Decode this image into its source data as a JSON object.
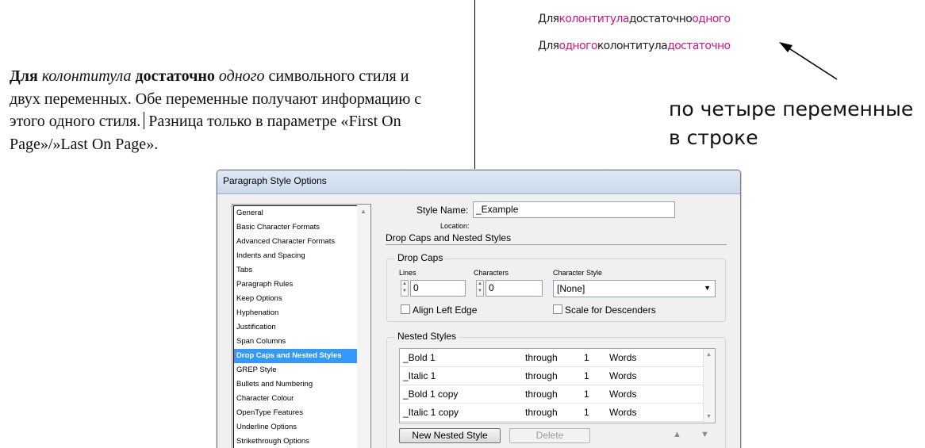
{
  "annotation": {
    "paragraph": {
      "w1": "Для",
      "w2": "колонтитула",
      "w3": "достаточно",
      "w4": "одного",
      "rest1": "символьного стиля и двух переменных. Обе переменные получают информацию с этого одного стиля.",
      "rest2": "Разница только в параметре «First On Page»/»Last On Page»."
    },
    "header_line_1": [
      {
        "text": "Для",
        "marked": false
      },
      {
        "text": "колонтитула",
        "marked": true
      },
      {
        "text": "достаточно",
        "marked": false
      },
      {
        "text": "одного",
        "marked": true
      }
    ],
    "header_line_2": [
      {
        "text": "Для",
        "marked": false
      },
      {
        "text": "одного",
        "marked": true
      },
      {
        "text": "колонтитула",
        "marked": false
      },
      {
        "text": "достаточно",
        "marked": true
      }
    ],
    "note_line_1": "по четыре переменные",
    "note_line_2": "в строке",
    "colors": {
      "magenta": "#d0148a",
      "text": "#111111"
    }
  },
  "dialog": {
    "title": "Paragraph Style Options",
    "sidebar": [
      {
        "label": "General",
        "selected": false
      },
      {
        "label": "Basic Character Formats",
        "selected": false
      },
      {
        "label": "Advanced Character Formats",
        "selected": false
      },
      {
        "label": "Indents and Spacing",
        "selected": false
      },
      {
        "label": "Tabs",
        "selected": false
      },
      {
        "label": "Paragraph Rules",
        "selected": false
      },
      {
        "label": "Keep Options",
        "selected": false
      },
      {
        "label": "Hyphenation",
        "selected": false
      },
      {
        "label": "Justification",
        "selected": false
      },
      {
        "label": "Span Columns",
        "selected": false
      },
      {
        "label": "Drop Caps and Nested Styles",
        "selected": true
      },
      {
        "label": "GREP Style",
        "selected": false
      },
      {
        "label": "Bullets and Numbering",
        "selected": false
      },
      {
        "label": "Character Colour",
        "selected": false
      },
      {
        "label": "OpenType Features",
        "selected": false
      },
      {
        "label": "Underline Options",
        "selected": false
      },
      {
        "label": "Strikethrough Options",
        "selected": false
      }
    ],
    "style_name_label": "Style Name:",
    "style_name_value": "_Example",
    "location_label": "Location:",
    "section_title": "Drop Caps and Nested Styles",
    "drop_caps": {
      "title": "Drop Caps",
      "lines_label": "Lines",
      "lines_value": "0",
      "characters_label": "Characters",
      "characters_value": "0",
      "char_style_label": "Character Style",
      "char_style_value": "[None]",
      "align_left_edge": "Align Left Edge",
      "scale_descenders": "Scale for Descenders"
    },
    "nested_styles": {
      "title": "Nested Styles",
      "rows": [
        {
          "style": "_Bold 1",
          "mode": "through",
          "count": "1",
          "unit": "Words"
        },
        {
          "style": "_Italic 1",
          "mode": "through",
          "count": "1",
          "unit": "Words"
        },
        {
          "style": "_Bold 1 copy",
          "mode": "through",
          "count": "1",
          "unit": "Words"
        },
        {
          "style": "_Italic 1 copy",
          "mode": "through",
          "count": "1",
          "unit": "Words"
        }
      ],
      "new_button": "New Nested Style",
      "delete_button": "Delete"
    },
    "icons": {
      "arrow_up": "▲",
      "arrow_down": "▼",
      "dropdown": "▼",
      "spin_up": "▲",
      "spin_down": "▼"
    }
  }
}
